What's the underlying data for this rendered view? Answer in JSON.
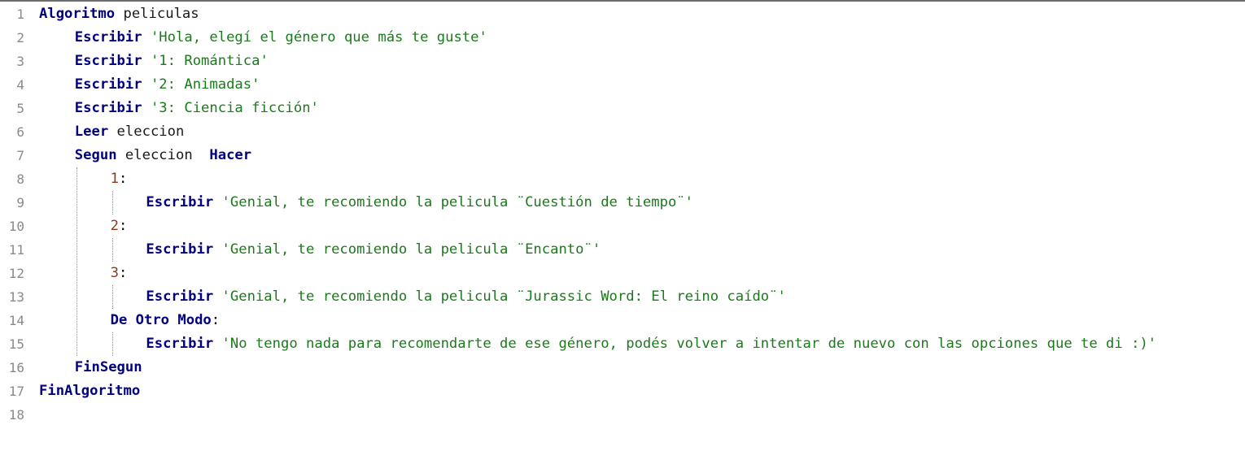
{
  "editor": {
    "lines": [
      {
        "n": "1",
        "indent": 0,
        "tokens": [
          {
            "t": "kw",
            "v": "Algoritmo"
          },
          {
            "t": "id",
            "v": " peliculas"
          }
        ]
      },
      {
        "n": "2",
        "indent": 4,
        "tokens": [
          {
            "t": "kw",
            "v": "Escribir"
          },
          {
            "t": "id",
            "v": " "
          },
          {
            "t": "str",
            "v": "'Hola, elegí el género que más te guste'"
          }
        ]
      },
      {
        "n": "3",
        "indent": 4,
        "tokens": [
          {
            "t": "kw",
            "v": "Escribir"
          },
          {
            "t": "id",
            "v": " "
          },
          {
            "t": "str",
            "v": "'1: Romántica'"
          }
        ]
      },
      {
        "n": "4",
        "indent": 4,
        "tokens": [
          {
            "t": "kw",
            "v": "Escribir"
          },
          {
            "t": "id",
            "v": " "
          },
          {
            "t": "str",
            "v": "'2: Animadas'"
          }
        ]
      },
      {
        "n": "5",
        "indent": 4,
        "tokens": [
          {
            "t": "kw",
            "v": "Escribir"
          },
          {
            "t": "id",
            "v": " "
          },
          {
            "t": "str",
            "v": "'3: Ciencia ficción'"
          }
        ]
      },
      {
        "n": "6",
        "indent": 4,
        "tokens": [
          {
            "t": "kw",
            "v": "Leer"
          },
          {
            "t": "id",
            "v": " eleccion"
          }
        ]
      },
      {
        "n": "7",
        "indent": 4,
        "tokens": [
          {
            "t": "kw",
            "v": "Segun"
          },
          {
            "t": "id",
            "v": " eleccion  "
          },
          {
            "t": "kw",
            "v": "Hacer"
          }
        ]
      },
      {
        "n": "8",
        "indent": 8,
        "tokens": [
          {
            "t": "num",
            "v": "1"
          },
          {
            "t": "op",
            "v": ":"
          }
        ]
      },
      {
        "n": "9",
        "indent": 12,
        "tokens": [
          {
            "t": "kw",
            "v": "Escribir"
          },
          {
            "t": "id",
            "v": " "
          },
          {
            "t": "str",
            "v": "'Genial, te recomiendo la pelicula ¨Cuestión de tiempo¨'"
          }
        ]
      },
      {
        "n": "10",
        "indent": 8,
        "tokens": [
          {
            "t": "num",
            "v": "2"
          },
          {
            "t": "op",
            "v": ":"
          }
        ]
      },
      {
        "n": "11",
        "indent": 12,
        "tokens": [
          {
            "t": "kw",
            "v": "Escribir"
          },
          {
            "t": "id",
            "v": " "
          },
          {
            "t": "str",
            "v": "'Genial, te recomiendo la pelicula ¨Encanto¨'"
          }
        ]
      },
      {
        "n": "12",
        "indent": 8,
        "tokens": [
          {
            "t": "num",
            "v": "3"
          },
          {
            "t": "op",
            "v": ":"
          }
        ]
      },
      {
        "n": "13",
        "indent": 12,
        "tokens": [
          {
            "t": "kw",
            "v": "Escribir"
          },
          {
            "t": "id",
            "v": " "
          },
          {
            "t": "str",
            "v": "'Genial, te recomiendo la pelicula ¨Jurassic Word: El reino caído¨'"
          }
        ]
      },
      {
        "n": "14",
        "indent": 8,
        "tokens": [
          {
            "t": "kw",
            "v": "De Otro Modo"
          },
          {
            "t": "op",
            "v": ":"
          }
        ]
      },
      {
        "n": "15",
        "indent": 12,
        "tokens": [
          {
            "t": "kw",
            "v": "Escribir"
          },
          {
            "t": "id",
            "v": " "
          },
          {
            "t": "str",
            "v": "'No tengo nada para recomendarte de ese género, podés volver a intentar de nuevo con las opciones que te di :)'"
          }
        ]
      },
      {
        "n": "16",
        "indent": 4,
        "tokens": [
          {
            "t": "kw",
            "v": "FinSegun"
          }
        ]
      },
      {
        "n": "17",
        "indent": 0,
        "tokens": [
          {
            "t": "kw",
            "v": "FinAlgoritmo"
          }
        ]
      },
      {
        "n": "18",
        "indent": 0,
        "tokens": []
      }
    ]
  },
  "colors": {
    "keyword": "#000080",
    "string": "#1b7a1b",
    "number": "#8b3a1a",
    "gutter": "#8a8a8a"
  }
}
